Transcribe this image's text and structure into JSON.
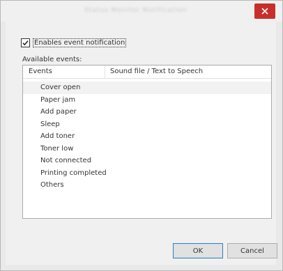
{
  "window": {
    "title": "Status Monitor Notification"
  },
  "enable_checkbox": {
    "checked": true,
    "label": "Enables event notification"
  },
  "available_label": "Available events:",
  "table": {
    "columns": [
      "Events",
      "Sound file / Text to Speech"
    ],
    "rows": [
      {
        "event": "Cover open",
        "sound": ""
      },
      {
        "event": "Paper jam",
        "sound": ""
      },
      {
        "event": "Add paper",
        "sound": ""
      },
      {
        "event": "Sleep",
        "sound": ""
      },
      {
        "event": "Add toner",
        "sound": ""
      },
      {
        "event": "Toner low",
        "sound": ""
      },
      {
        "event": "Not connected",
        "sound": ""
      },
      {
        "event": "Printing completed",
        "sound": ""
      },
      {
        "event": "Others",
        "sound": ""
      }
    ],
    "selected_row": 0
  },
  "buttons": {
    "ok": "OK",
    "cancel": "Cancel"
  },
  "colors": {
    "close_button": "#c7302a",
    "ok_border": "#3c7fb1"
  }
}
